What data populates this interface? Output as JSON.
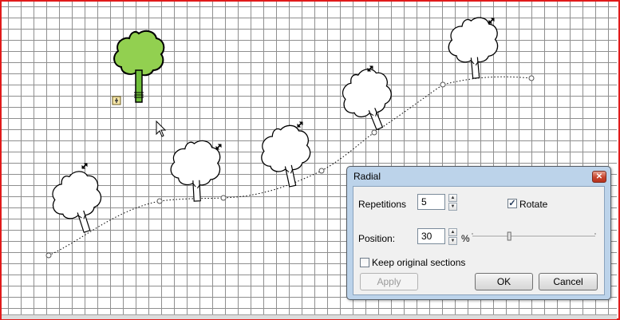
{
  "dialog": {
    "title": "Radial",
    "close_glyph": "✕",
    "repetitions_label": "Repetitions",
    "repetitions_value": "5",
    "rotate_label": "Rotate",
    "rotate_checked": true,
    "position_label": "Position:",
    "position_value": "30",
    "position_unit": "%",
    "position_percent": 30,
    "keep_sections_label": "Keep original sections",
    "keep_sections_checked": false,
    "apply_label": "Apply",
    "ok_label": "OK",
    "cancel_label": "Cancel"
  },
  "icons": {
    "spin_up": "▲",
    "spin_down": "▼",
    "check": "✓"
  },
  "colors": {
    "canvas_border": "#e11b1b",
    "grid_line": "#8f8f8f",
    "selected_tree_fill": "#92d050",
    "selected_trunk_fill": "#6fbf3a",
    "dialog_frame": "#bcd3ea"
  }
}
